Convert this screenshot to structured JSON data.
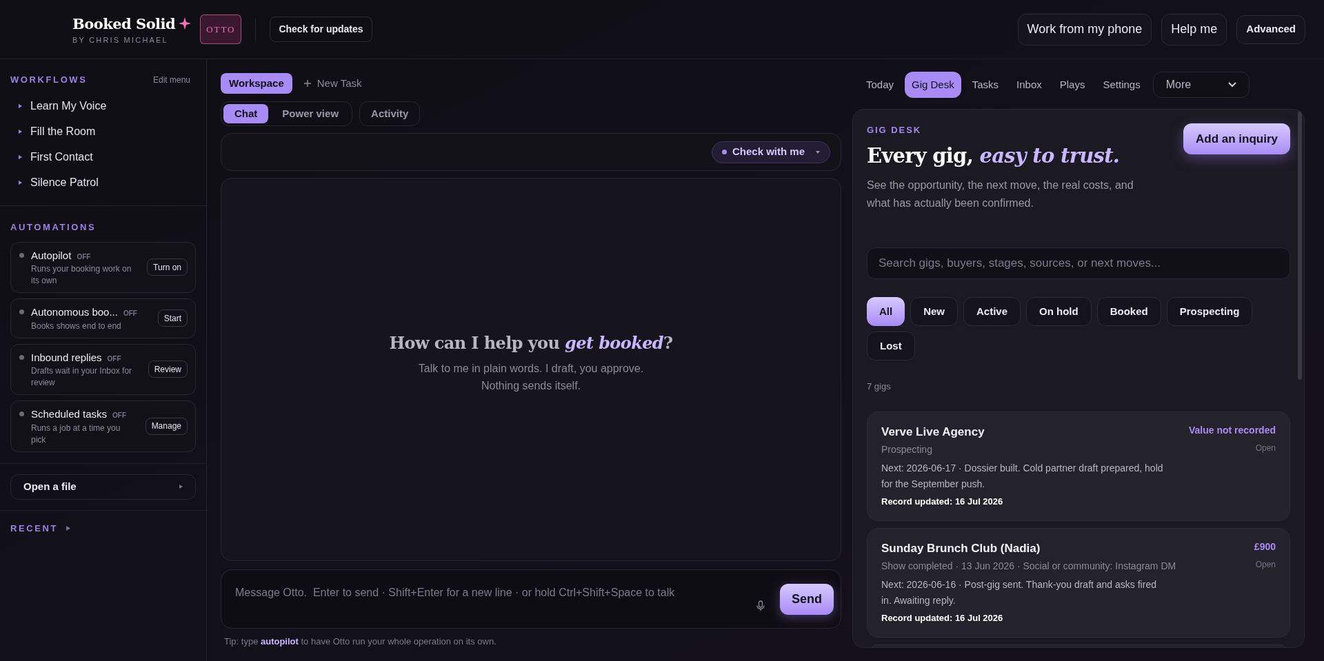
{
  "header": {
    "brand": "Booked Solid",
    "byline": "BY CHRIS MICHAEL",
    "badge": "OTTO",
    "update_button": "Check for updates",
    "actions": [
      "Work from my phone",
      "Help me",
      "Advanced"
    ]
  },
  "sidebar": {
    "workflows_title": "WORKFLOWS",
    "edit_link": "Edit menu",
    "workflows": [
      "Learn My Voice",
      "Fill the Room",
      "First Contact",
      "Silence Patrol"
    ],
    "automations_title": "AUTOMATIONS",
    "automations": [
      {
        "name": "Autopilot",
        "status": "OFF",
        "on": false,
        "description": "Runs your booking work on its own",
        "button": "Turn on"
      },
      {
        "name": "Autonomous boo...",
        "status": "OFF",
        "on": false,
        "description": "Books shows end to end",
        "button": "Start"
      },
      {
        "name": "Inbound replies",
        "status": "OFF",
        "on": false,
        "description": "Drafts wait in your Inbox for review",
        "button": "Review"
      },
      {
        "name": "Scheduled tasks",
        "status": "OFF",
        "on": false,
        "description": "Runs a job at a time you pick",
        "button": "Manage"
      }
    ],
    "open_file": "Open a file",
    "recent_title": "RECENT"
  },
  "center": {
    "tabs": [
      {
        "label": "Workspace",
        "selected": true
      }
    ],
    "new_task": "New Task",
    "views": [
      {
        "label": "Chat",
        "selected": true
      },
      {
        "label": "Power view",
        "selected": false
      }
    ],
    "activity": "Activity",
    "mode": "Check with me",
    "empty_title": "How can I help you *get booked*?",
    "empty_lines": [
      "Talk to me in plain words. I draft, you approve.",
      "Nothing sends itself."
    ],
    "message": {
      "placeholder": "Message Otto.  Enter to send · Shift+Enter for a new line · or hold Ctrl+Shift+Space to talk"
    },
    "send": "Send",
    "tip": "Tip: type **autopilot** to have Otto run your whole operation on its own."
  },
  "right": {
    "nav": [
      {
        "label": "Today",
        "selected": false
      },
      {
        "label": "Gig Desk",
        "selected": true
      },
      {
        "label": "Tasks",
        "selected": false
      },
      {
        "label": "Inbox",
        "selected": false
      },
      {
        "label": "Plays",
        "selected": false
      },
      {
        "label": "Settings",
        "selected": false
      }
    ],
    "more": "More",
    "eyebrow": "GIG DESK",
    "heading": "Every gig, *easy to trust.*",
    "description": "See the opportunity, the next move, the real costs, and what has actually been confirmed.",
    "add_button": "Add an inquiry",
    "search": {
      "placeholder": "Search gigs, buyers, stages, sources, or next moves..."
    },
    "filters": [
      {
        "label": "All",
        "selected": true
      },
      {
        "label": "New",
        "selected": false
      },
      {
        "label": "Active",
        "selected": false
      },
      {
        "label": "On hold",
        "selected": false
      },
      {
        "label": "Booked",
        "selected": false
      },
      {
        "label": "Prospecting",
        "selected": false
      },
      {
        "label": "Lost",
        "selected": false
      }
    ],
    "count": "7 gigs",
    "gigs": [
      {
        "name": "Verve Live Agency",
        "value": "Value not recorded",
        "status": "Open",
        "stage": "Prospecting",
        "next": "Next: 2026-06-17 · Dossier built. Cold partner draft prepared, hold for the September push.",
        "updated": "Record updated: 16 Jul 2026"
      },
      {
        "name": "Sunday Brunch Club (Nadia)",
        "value": "£900",
        "status": "Open",
        "stage": "Show completed · 13 Jun 2026 · Social or community: Instagram DM",
        "next": "Next: 2026-06-16 · Post-gig sent. Thank-you draft and asks fired in. Awaiting reply.",
        "updated": "Record updated: 16 Jul 2026"
      }
    ]
  }
}
